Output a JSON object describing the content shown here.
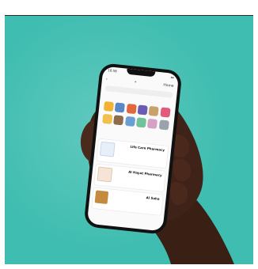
{
  "colors": {
    "background_teal": "#3fbdb0",
    "skin": "#3d2116",
    "phone_frame": "#111111",
    "screen": "#fafafa",
    "accent": "#d3472b"
  },
  "phone": {
    "status_time": "10:58",
    "header": {
      "left_icon": "chevron-left-icon",
      "middle_icon": "location-pin-icon",
      "right_label": "Home"
    },
    "search_placeholder": "",
    "tabs": [
      "",
      "",
      "",
      "",
      ""
    ],
    "category_icons": [
      "grocery-icon",
      "pharmacy-icon",
      "restaurant-icon",
      "electronics-icon",
      "bakery-icon",
      "gift-icon",
      "sweets-icon",
      "coffee-icon",
      "pet-icon",
      "flowers-icon",
      "beauty-icon",
      "more-icon"
    ],
    "section_title": "",
    "stores": [
      {
        "name": "Life Care Pharmacy",
        "meta": ""
      },
      {
        "name": "Al Hayat Pharmacy",
        "meta": ""
      },
      {
        "name": "Al Saha",
        "meta": ""
      }
    ]
  }
}
